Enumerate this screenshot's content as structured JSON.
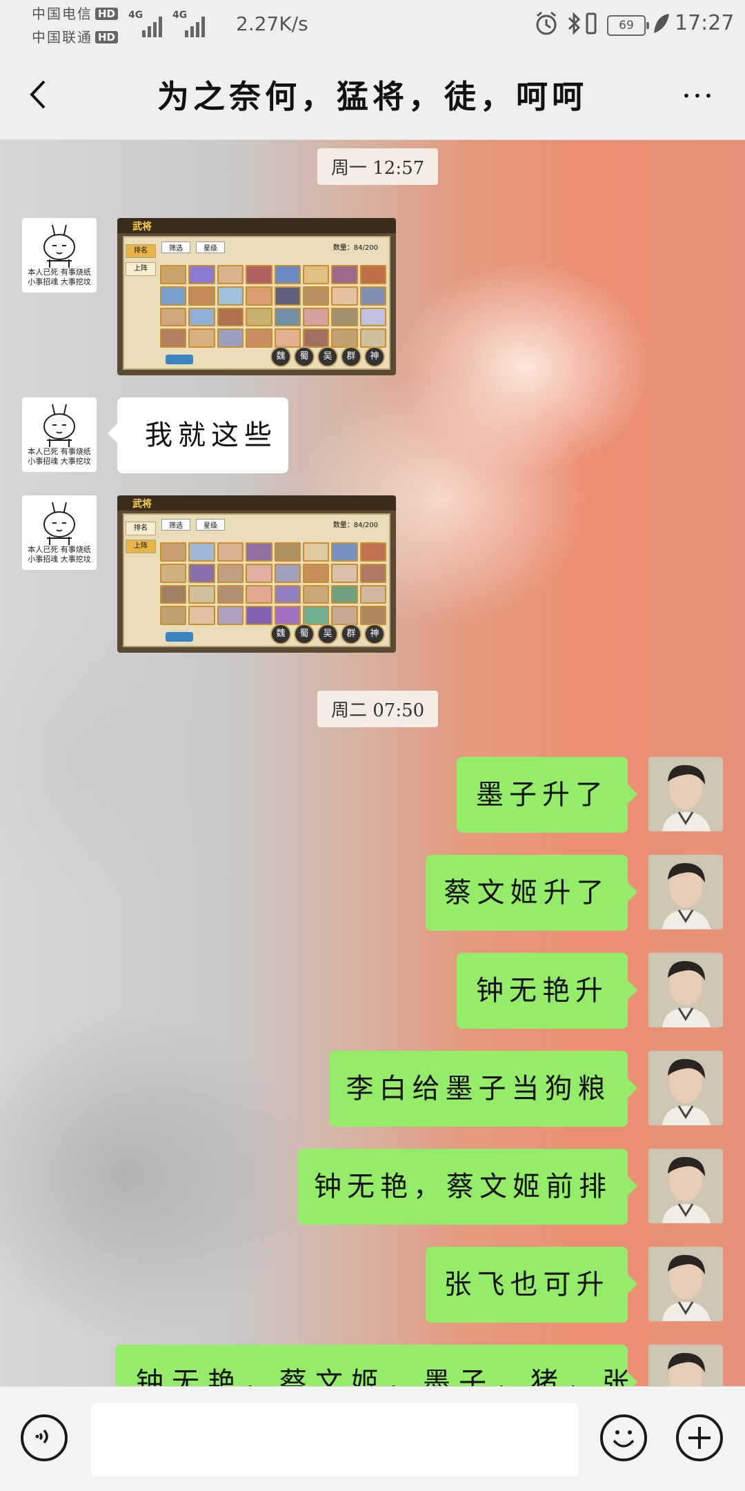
{
  "status_bar": {
    "carrier1": "中国电信",
    "carrier2": "中国联通",
    "hd": "HD",
    "net1": "4G",
    "net2": "4G",
    "speed": "2.27K/s",
    "battery": "69",
    "time": "17:27"
  },
  "header": {
    "title": "为之奈何，猛将，徒，呵呵"
  },
  "avatar_left_caption": [
    "本人已死 有事烧纸",
    "小事招魂 大事挖坟"
  ],
  "messages": [
    {
      "type": "timestamp",
      "text": "周一 12:57"
    },
    {
      "type": "image",
      "side": "left",
      "screen": "武将",
      "count": "数量：84/200",
      "filters": [
        "筛选",
        "星级"
      ],
      "side_buttons": [
        "排名",
        "上阵"
      ],
      "tabs": [
        "魏",
        "蜀",
        "吴",
        "群",
        "神"
      ]
    },
    {
      "type": "text",
      "side": "left",
      "text": "我就这些"
    },
    {
      "type": "image",
      "side": "left",
      "screen": "武将",
      "count": "数量：84/200",
      "filters": [
        "筛选",
        "星级"
      ],
      "side_buttons": [
        "排名",
        "上阵"
      ],
      "tabs": [
        "魏",
        "蜀",
        "吴",
        "群",
        "神"
      ]
    },
    {
      "type": "timestamp",
      "text": "周二 07:50"
    },
    {
      "type": "text",
      "side": "right",
      "text": "墨子升了"
    },
    {
      "type": "text",
      "side": "right",
      "text": "蔡文姬升了"
    },
    {
      "type": "text",
      "side": "right",
      "text": "钟无艳升"
    },
    {
      "type": "text",
      "side": "right",
      "text": "李白给墨子当狗粮"
    },
    {
      "type": "text",
      "side": "right",
      "text": "钟无艳，蔡文姬前排"
    },
    {
      "type": "text",
      "side": "right",
      "text": "张飞也可升"
    },
    {
      "type": "text",
      "side": "right",
      "text": "钟无艳，蔡文姬，墨子，猪，张"
    }
  ],
  "input": {
    "voice_icon": "voice-icon",
    "emoji_icon": "emoji-icon",
    "plus_icon": "plus-icon",
    "value": ""
  },
  "colors": {
    "bubble_out": "#95ec69",
    "bubble_in": "#ffffff",
    "bar_bg": "#efefef"
  }
}
